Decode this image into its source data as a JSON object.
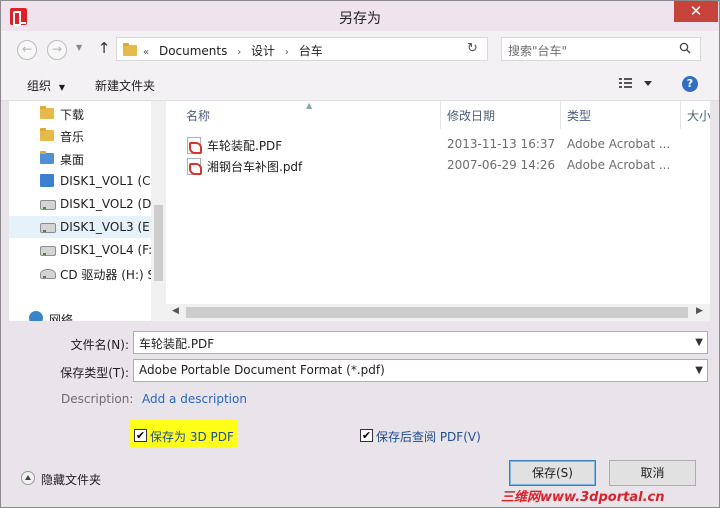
{
  "window": {
    "title": "另存为",
    "close_glyph": "✕"
  },
  "address": {
    "chevrons": "«",
    "crumbs": [
      "Documents",
      "设计",
      "台车"
    ],
    "search_placeholder": "搜索\"台车\""
  },
  "toolbar": {
    "organize": "组织",
    "new_folder": "新建文件夹"
  },
  "nav": {
    "items": [
      {
        "label": "下载",
        "icon": "download-folder-icon"
      },
      {
        "label": "音乐",
        "icon": "music-folder-icon"
      },
      {
        "label": "桌面",
        "icon": "desktop-folder-icon"
      },
      {
        "label": "DISK1_VOL1 (C:",
        "icon": "system-drive-icon"
      },
      {
        "label": "DISK1_VOL2 (D",
        "icon": "drive-icon"
      },
      {
        "label": "DISK1_VOL3 (E:",
        "icon": "drive-icon",
        "selected": true
      },
      {
        "label": "DISK1_VOL4 (F:",
        "icon": "drive-icon"
      },
      {
        "label": "CD 驱动器 (H:) S",
        "icon": "cd-drive-icon"
      }
    ],
    "network": "网络"
  },
  "columns": {
    "name": "名称",
    "date": "修改日期",
    "type": "类型",
    "size": "大小"
  },
  "files": [
    {
      "name": "车轮装配.PDF",
      "date": "2013-11-13 16:37",
      "type": "Adobe Acrobat ..."
    },
    {
      "name": "湘钢台车补图.pdf",
      "date": "2007-06-29 14:26",
      "type": "Adobe Acrobat ..."
    }
  ],
  "form": {
    "filename_label": "文件名(N):",
    "filename_value": "车轮装配.PDF",
    "filetype_label": "保存类型(T):",
    "filetype_value": "Adobe Portable Document Format (*.pdf)",
    "description_label": "Description:",
    "description_link": "Add a description",
    "save_3d_label": "保存为 3D PDF",
    "save_3d_checked": true,
    "view_after_label": "保存后查阅 PDF(V)",
    "view_after_checked": true,
    "hide_folders": "隐藏文件夹",
    "save_button": "保存(S)",
    "cancel_button": "取消"
  },
  "watermark": "三维网www.3dportal.cn",
  "colors": {
    "highlight": "#ffff1a",
    "link": "#2c67b8",
    "close": "#c7423b",
    "selection": "#e5f1fb"
  }
}
